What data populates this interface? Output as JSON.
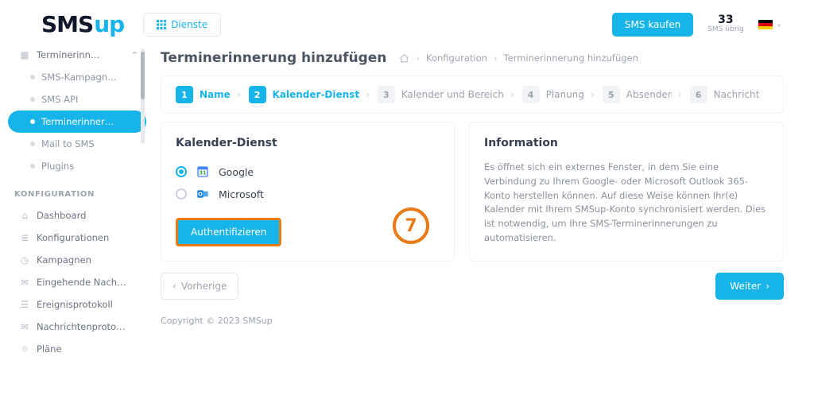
{
  "brand": {
    "name_a": "SMS",
    "name_b": "up"
  },
  "topbar": {
    "services_btn": "Dienste",
    "buy_btn": "SMS kaufen",
    "credits": {
      "count": "33",
      "label": "SMS übrig"
    }
  },
  "sidebar": {
    "items": [
      {
        "label": "Terminerinn…",
        "kind": "parent",
        "open": true
      },
      {
        "label": "SMS-Kampagn…",
        "kind": "sub"
      },
      {
        "label": "SMS API",
        "kind": "sub"
      },
      {
        "label": "Terminerinner…",
        "kind": "sub",
        "active": true
      },
      {
        "label": "Mail to SMS",
        "kind": "sub"
      },
      {
        "label": "Plugins",
        "kind": "sub"
      }
    ],
    "group_label": "KONFIGURATION",
    "config": [
      {
        "label": "Dashboard",
        "icon": "home"
      },
      {
        "label": "Konfigurationen",
        "icon": "sliders"
      },
      {
        "label": "Kampagnen",
        "icon": "clock"
      },
      {
        "label": "Eingehende Nach…",
        "icon": "inbox"
      },
      {
        "label": "Ereignisprotokoll",
        "icon": "list"
      },
      {
        "label": "Nachrichtenproto…",
        "icon": "message"
      },
      {
        "label": "Pläne",
        "icon": "bulb"
      }
    ]
  },
  "page": {
    "title": "Terminerinnerung hinzufügen",
    "crumbs": [
      "Konfiguration",
      "Terminerinnerung hinzufügen"
    ]
  },
  "wizard": {
    "steps": [
      {
        "n": "1",
        "label": "Name",
        "state": "done"
      },
      {
        "n": "2",
        "label": "Kalender-Dienst",
        "state": "current"
      },
      {
        "n": "3",
        "label": "Kalender und Bereich",
        "state": "todo"
      },
      {
        "n": "4",
        "label": "Planung",
        "state": "todo"
      },
      {
        "n": "5",
        "label": "Absender",
        "state": "todo"
      },
      {
        "n": "6",
        "label": "Nachricht",
        "state": "todo"
      }
    ]
  },
  "panel": {
    "title": "Kalender-Dienst",
    "options": [
      {
        "label": "Google",
        "checked": true
      },
      {
        "label": "Microsoft",
        "checked": false
      }
    ],
    "auth_btn": "Authentifizieren"
  },
  "info": {
    "title": "Information",
    "body": "Es öffnet sich ein externes Fenster, in dem Sie eine Verbindung zu Ihrem Google- oder Microsoft Outlook 365-Konto herstellen können.\nAuf diese Weise können Ihr(e) Kalender mit Ihrem SMSup-Konto synchronisiert werden. Dies ist notwendig, um Ihre SMS-Terminerinnerungen zu automatisieren."
  },
  "pager": {
    "prev": "Vorherige",
    "next": "Weiter"
  },
  "footer": "Copyright © 2023 SMSup",
  "tutorial": {
    "step": "7"
  }
}
